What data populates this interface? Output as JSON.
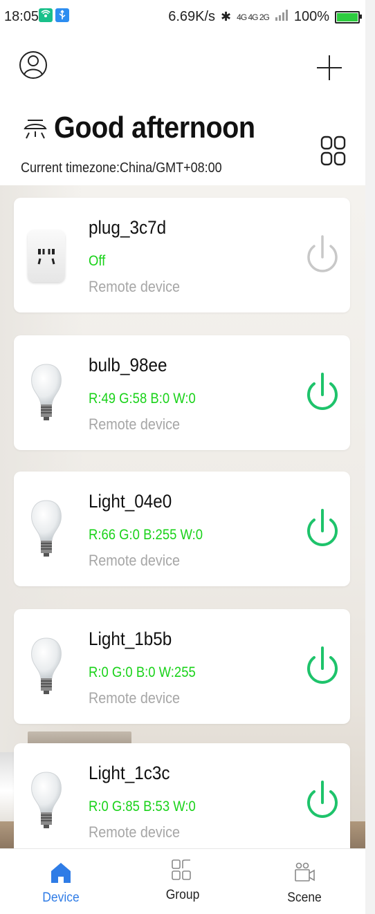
{
  "status_bar": {
    "time": "18:05",
    "net_speed": "6.69K/s",
    "signal_text": "4G 4G 2G",
    "battery": "100%"
  },
  "header": {
    "greeting": "Good afternoon",
    "timezone": "Current timezone:China/GMT+08:00"
  },
  "devices": [
    {
      "name": "plug_3c7d",
      "state": "Off",
      "location": "Remote device",
      "type": "plug",
      "on": false
    },
    {
      "name": "bulb_98ee",
      "state": "R:49 G:58 B:0 W:0",
      "location": "Remote device",
      "type": "bulb",
      "on": true
    },
    {
      "name": "Light_04e0",
      "state": "R:66 G:0 B:255 W:0",
      "location": "Remote device",
      "type": "bulb",
      "on": true
    },
    {
      "name": "Light_1b5b",
      "state": "R:0 G:0 B:0 W:255",
      "location": "Remote device",
      "type": "bulb",
      "on": true
    },
    {
      "name": "Light_1c3c",
      "state": "R:0 G:85 B:53 W:0",
      "location": "Remote device",
      "type": "bulb",
      "on": true
    }
  ],
  "bottom_nav": [
    {
      "label": "Device",
      "icon": "home-icon",
      "active": true
    },
    {
      "label": "Group",
      "icon": "group-grid-icon",
      "active": false
    },
    {
      "label": "Scene",
      "icon": "scene-icon",
      "active": false
    }
  ],
  "colors": {
    "accent": "#2f7ce6",
    "status_green": "#19d219",
    "power_on": "#1ec36b",
    "power_off": "#c8c8c8"
  }
}
